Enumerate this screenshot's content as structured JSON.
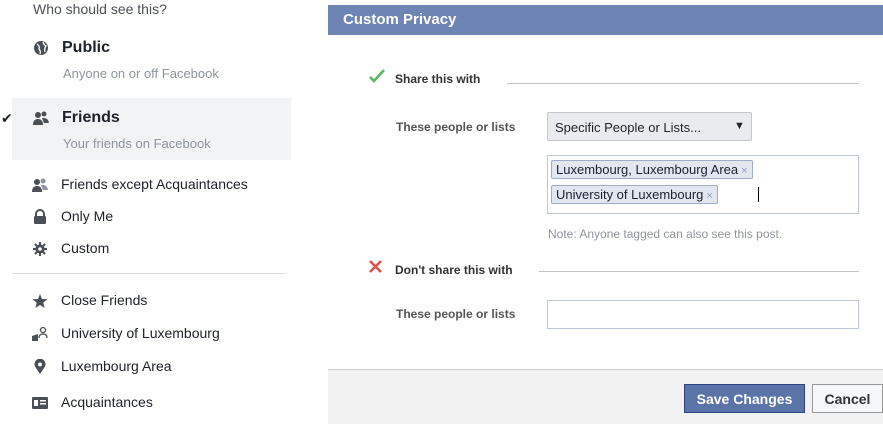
{
  "menu": {
    "header": "Who should see this?",
    "options": [
      {
        "title": "Public",
        "subtitle": "Anyone on or off Facebook",
        "icon": "globe-icon"
      },
      {
        "title": "Friends",
        "subtitle": "Your friends on Facebook",
        "icon": "friends-icon",
        "selected": true,
        "check": "✔"
      }
    ],
    "items": [
      {
        "label": "Friends except Acquaintances",
        "icon": "friends-except-icon"
      },
      {
        "label": "Only Me",
        "icon": "lock-icon"
      },
      {
        "label": "Custom",
        "icon": "gear-icon"
      }
    ],
    "lists": [
      {
        "label": "Close Friends",
        "icon": "star-icon"
      },
      {
        "label": "University of Luxembourg",
        "icon": "building-icon"
      },
      {
        "label": "Luxembourg Area",
        "icon": "location-pin-icon"
      },
      {
        "label": "Acquaintances",
        "icon": "id-card-icon"
      }
    ]
  },
  "dialog": {
    "title": "Custom Privacy",
    "share": {
      "title": "Share this with",
      "icon": "green-check-icon",
      "row_label": "These people or lists",
      "select_value": "Specific People or Lists...",
      "caret": "▼",
      "tokens": [
        "Luxembourg, Luxembourg Area",
        "University of Luxembourg"
      ],
      "remove_glyph": "×",
      "note": "Note: Anyone tagged can also see this post."
    },
    "dont_share": {
      "title": "Don't share this with",
      "icon": "red-x-icon",
      "row_label": "These people or lists",
      "input_value": ""
    },
    "buttons": {
      "save": "Save Changes",
      "cancel": "Cancel"
    }
  },
  "colors": {
    "header": "#6d84b4",
    "save_button": "#5b74a8",
    "check_green": "#5cb85c",
    "x_red": "#d9534f"
  }
}
